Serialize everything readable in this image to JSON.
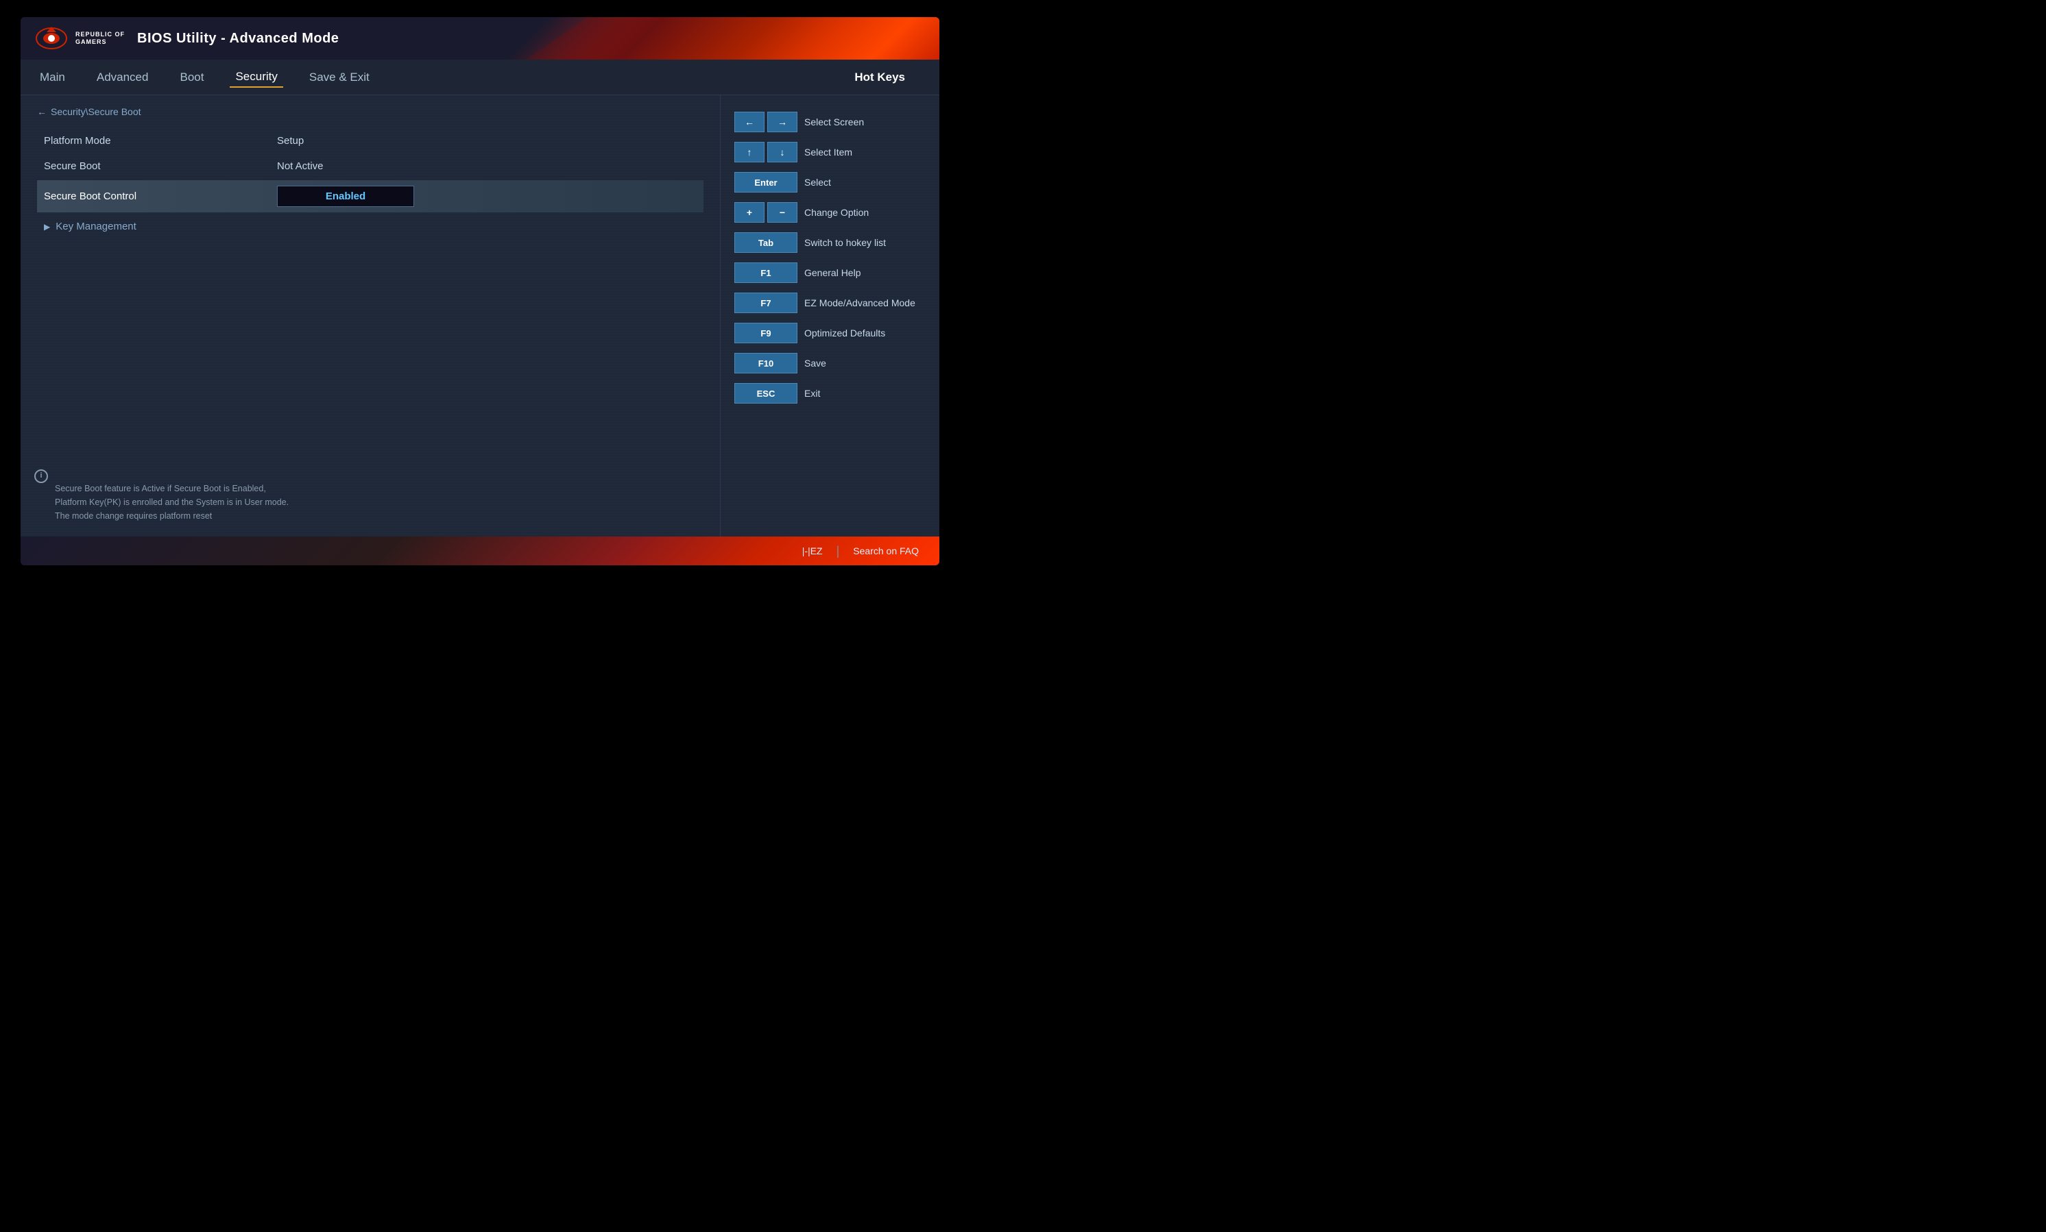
{
  "header": {
    "brand_line1": "REPUBLIC OF",
    "brand_line2": "GAMERS",
    "title": "BIOS Utility - Advanced Mode"
  },
  "nav": {
    "items": [
      {
        "label": "Main",
        "active": false
      },
      {
        "label": "Advanced",
        "active": false
      },
      {
        "label": "Boot",
        "active": false
      },
      {
        "label": "Security",
        "active": true
      },
      {
        "label": "Save & Exit",
        "active": false
      }
    ],
    "hot_keys_label": "Hot Keys"
  },
  "breadcrumb": {
    "back_arrow": "←",
    "path": "Security\\Secure Boot"
  },
  "settings": [
    {
      "label": "Platform Mode",
      "value": "Setup",
      "selected": false
    },
    {
      "label": "Secure Boot",
      "value": "Not Active",
      "selected": false
    },
    {
      "label": "Secure Boot Control",
      "value": "Enabled",
      "selected": true
    }
  ],
  "key_management": {
    "label": "Key Management",
    "arrow": "▶"
  },
  "info_text": "Secure Boot feature is Active if Secure Boot is Enabled,\nPlatform Key(PK) is enrolled and the System is in User mode.\nThe mode change requires platform reset",
  "hotkeys": [
    {
      "keys": [
        "←",
        "→"
      ],
      "label": "Select Screen",
      "pair": true
    },
    {
      "keys": [
        "↑",
        "↓"
      ],
      "label": "Select Item",
      "pair": true
    },
    {
      "keys": [
        "Enter"
      ],
      "label": "Select",
      "pair": false
    },
    {
      "keys": [
        "+",
        "−"
      ],
      "label": "Change Option",
      "pair": true
    },
    {
      "keys": [
        "Tab"
      ],
      "label": "Switch to hokey list",
      "pair": false
    },
    {
      "keys": [
        "F1"
      ],
      "label": "General Help",
      "pair": false
    },
    {
      "keys": [
        "F7"
      ],
      "label": "EZ Mode/Advanced Mode",
      "pair": false
    },
    {
      "keys": [
        "F9"
      ],
      "label": "Optimized Defaults",
      "pair": false
    },
    {
      "keys": [
        "F10"
      ],
      "label": "Save",
      "pair": false
    },
    {
      "keys": [
        "ESC"
      ],
      "label": "Exit",
      "pair": false
    }
  ],
  "bottom_bar": {
    "ez_label": "|-|EZ",
    "divider": "|",
    "faq_label": "Search on FAQ"
  }
}
